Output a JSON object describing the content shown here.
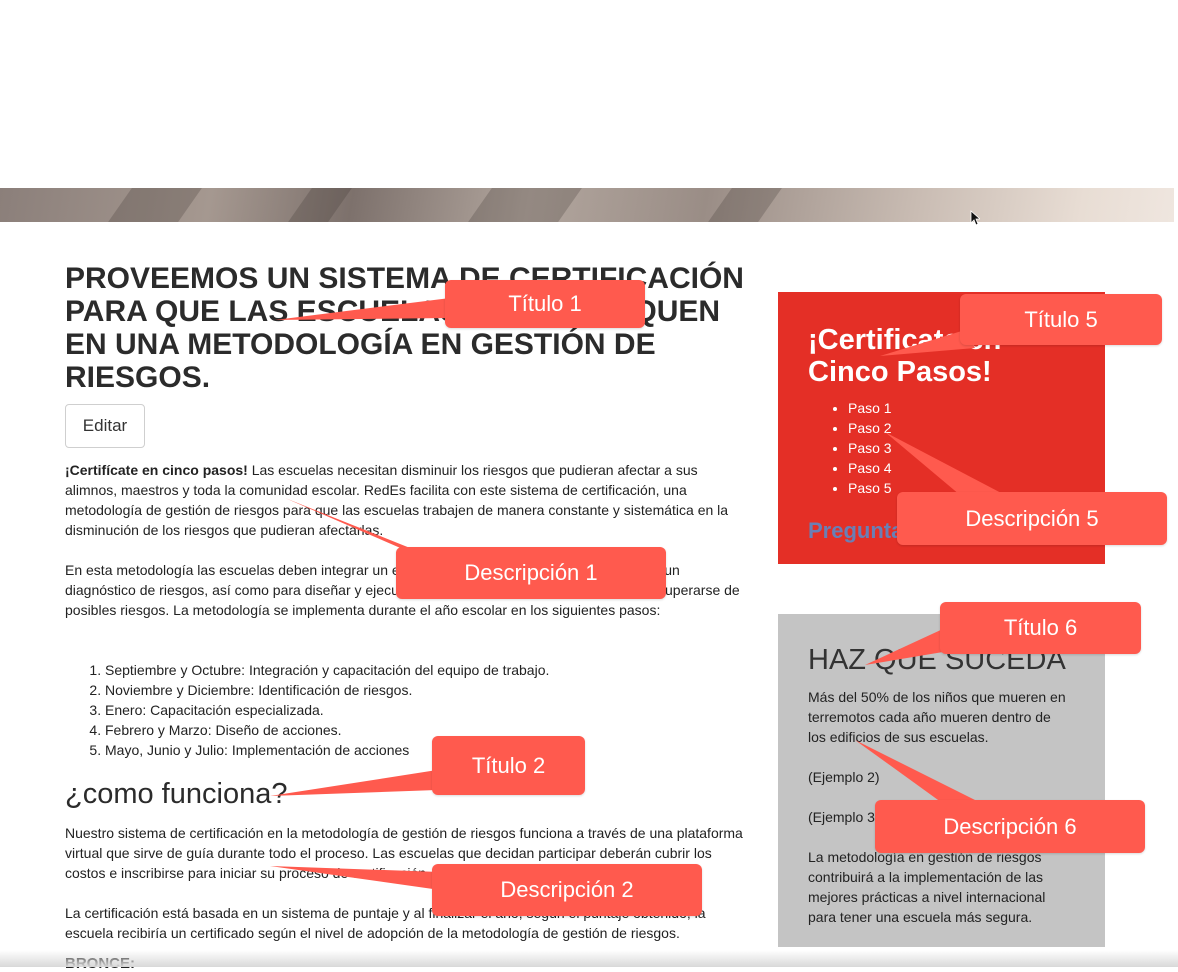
{
  "main": {
    "title": "PROVEEMOS UN SISTEMA DE CERTIFICACIÓN PARA QUE LAS ESCUELAS SE CERTIFIQUEN EN UNA METODOLOGÍA EN GESTIÓN DE RIESGOS.",
    "edit_label": "Editar",
    "intro_bold": "¡Certifícate en cinco pasos!",
    "intro_text": " Las escuelas necesitan disminuir los riesgos que pudieran afectar a sus alimnos, maestros y toda la comunidad escolar. RedEs facilita con este sistema de certificación, una metodología de gestión de riesgos para que las escuelas trabajen de manera constante y sistemática en la disminución de los riesgos que pudieran afectarlas.",
    "method_text": "En esta metodología las escuelas deben integrar un equipo de trabajo y realizar periódicamente un diagnóstico de riesgos, así como para diseñar y ejecutar acciones para prevenir, responder y recuperarse de posibles riesgos. La metodología se implementa durante el año escolar en los siguientes pasos:",
    "steps": [
      "Septiembre y Octubre: Integración y capacitación del equipo de trabajo.",
      "Noviembre y Diciembre: Identificación de riesgos.",
      "Enero: Capacitación especializada.",
      "Febrero y Marzo: Diseño de acciones.",
      "Mayo, Junio y Julio: Implementación de acciones"
    ],
    "how_title": "¿como funciona?",
    "how_text": "Nuestro sistema de certificación en la metodología de gestión de riesgos funciona a través de una plataforma virtual que sirve de guía durante todo el proceso. Las escuelas que decidan participar deberán cubrir los costos e inscribirse para iniciar su proceso de certificación.",
    "cert_text": " La certificación está basada en un sistema de puntaje y al finalizar el año, según el puntaje obtenido, la escuela recibiría un certificado según el nivel de adopción de la metodología de gestión de riesgos.",
    "bronze": "BRONCE:"
  },
  "red_box": {
    "title": "¡Certificate en Cinco Pasos!",
    "items": [
      "Paso 1",
      "Paso 2",
      "Paso 3",
      "Paso 4",
      "Paso 5"
    ],
    "link": "Preguntas"
  },
  "gray_box": {
    "title": "HAZ QUE SUCEDA",
    "text1": "Más del 50% de los niños que mueren en terremotos cada año mueren dentro de los edificios de sus escuelas.",
    "text2": " (Ejemplo 2)",
    "text3": " (Ejemplo 3)",
    "text4": " La metodología en gestión de riesgos contribuirá a la implementación de las mejores prácticas a nivel internacional para tener una escuela más segura."
  },
  "callouts": {
    "t1": "Título 1",
    "d1": "Descripción 1",
    "t2": "Título 2",
    "d2": "Descripción 2",
    "t5": "Título 5",
    "d5": "Descripción 5",
    "t6": "Título 6",
    "d6": "Descripción 6"
  },
  "colors": {
    "callout": "#ff5a4e",
    "red_box": "#e42f26",
    "gray_box": "#c4c4c4",
    "link": "#6a7fb5"
  }
}
